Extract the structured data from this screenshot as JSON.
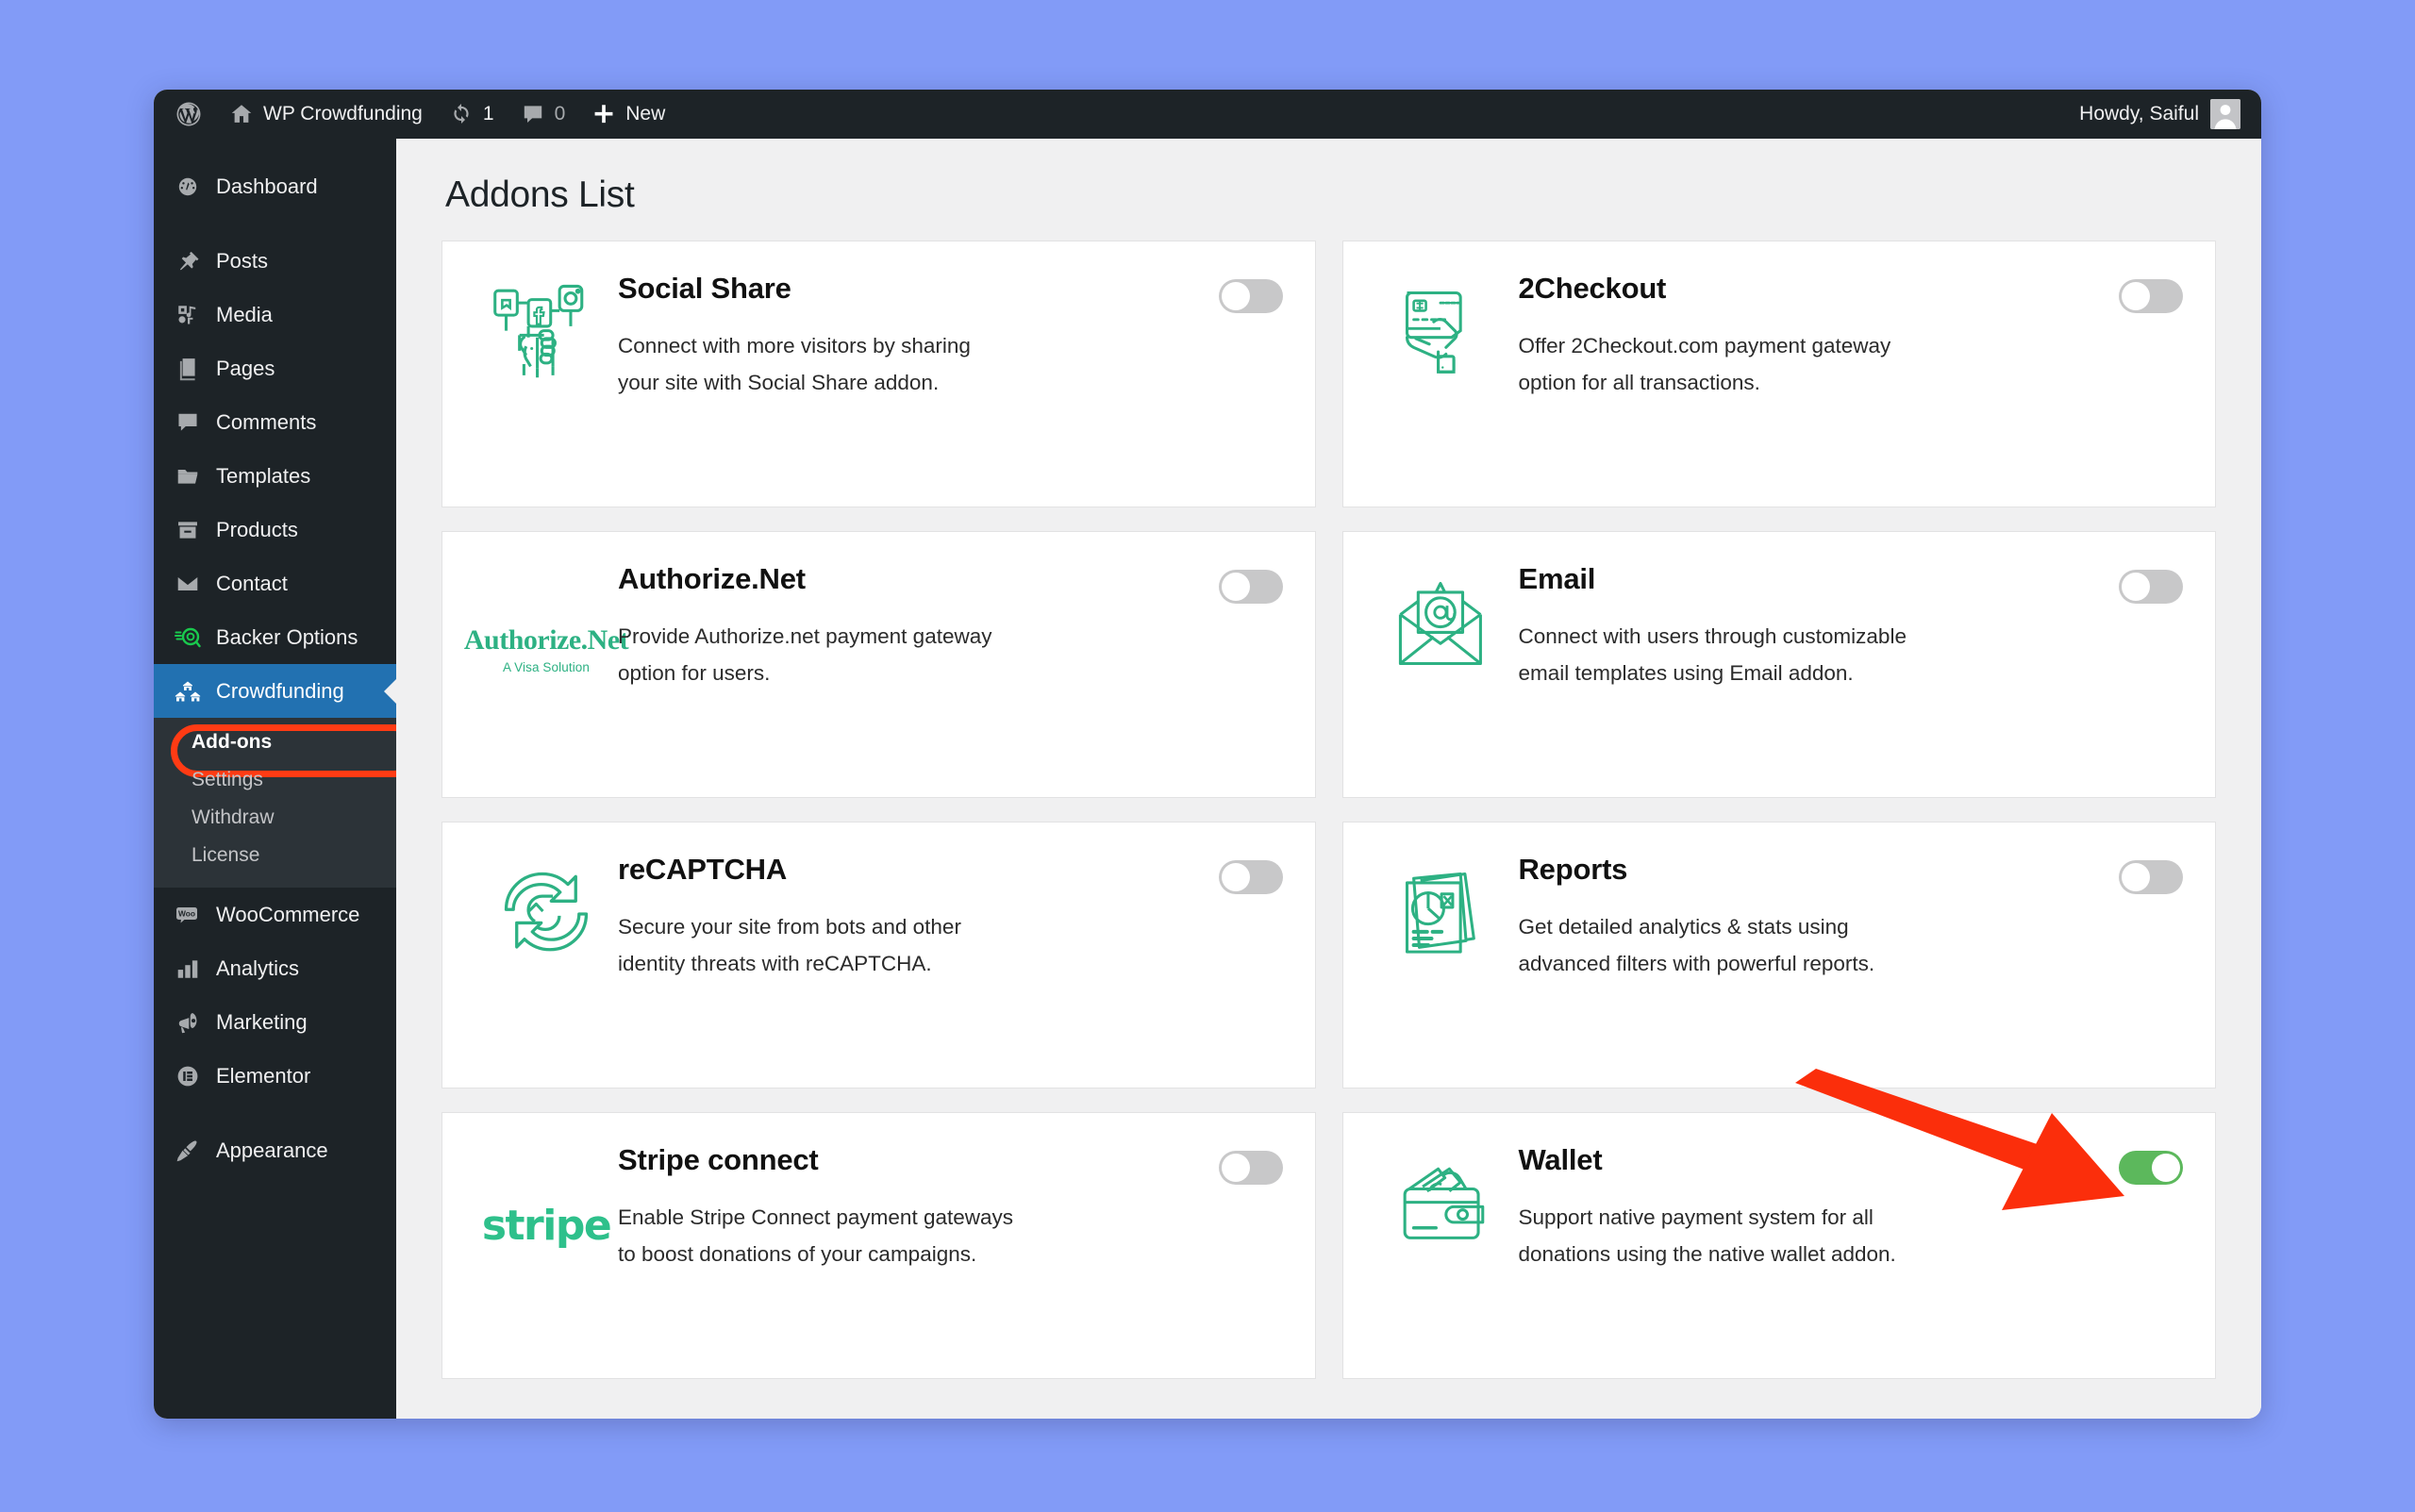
{
  "window": {
    "background_color": "#829bf7",
    "accent_blue": "#2271b1",
    "brand_green": "#2db183",
    "highlight_red": "#ff3b14"
  },
  "adminbar": {
    "site_name": "WP Crowdfunding",
    "updates_count": "1",
    "comments_count": "0",
    "new_label": "New",
    "howdy": "Howdy, Saiful"
  },
  "sidebar": {
    "items": [
      {
        "label": "Dashboard",
        "icon": "dashboard-icon",
        "active": false
      },
      {
        "label": "Posts",
        "icon": "pin-icon",
        "active": false
      },
      {
        "label": "Media",
        "icon": "media-icon",
        "active": false
      },
      {
        "label": "Pages",
        "icon": "pages-icon",
        "active": false
      },
      {
        "label": "Comments",
        "icon": "comment-icon",
        "active": false
      },
      {
        "label": "Templates",
        "icon": "folder-icon",
        "active": false
      },
      {
        "label": "Products",
        "icon": "products-icon",
        "active": false
      },
      {
        "label": "Contact",
        "icon": "envelope-icon",
        "active": false
      },
      {
        "label": "Backer Options",
        "icon": "backer-options-icon",
        "active": false
      },
      {
        "label": "Crowdfunding",
        "icon": "crowdfunding-icon",
        "active": true
      },
      {
        "label": "WooCommerce",
        "icon": "woo-icon",
        "active": false
      },
      {
        "label": "Analytics",
        "icon": "bar-chart-icon",
        "active": false
      },
      {
        "label": "Marketing",
        "icon": "megaphone-icon",
        "active": false
      },
      {
        "label": "Elementor",
        "icon": "elementor-icon",
        "active": false
      },
      {
        "label": "Appearance",
        "icon": "paintbrush-icon",
        "active": false
      }
    ],
    "submenu": [
      {
        "label": "Add-ons",
        "current": true
      },
      {
        "label": "Settings",
        "current": false
      },
      {
        "label": "Withdraw",
        "current": false
      },
      {
        "label": "License",
        "current": false
      }
    ]
  },
  "main": {
    "page_title": "Addons List",
    "addons": [
      {
        "name": "Social Share",
        "description": "Connect with more visitors by sharing your site with Social Share addon.",
        "icon": "social-share-icon",
        "enabled": false
      },
      {
        "name": "2Checkout",
        "description": "Offer 2Checkout.com payment gateway option for all transactions.",
        "icon": "credit-card-hand-icon",
        "enabled": false
      },
      {
        "name": "Authorize.Net",
        "description": "Provide Authorize.net payment gateway option for users.",
        "icon": "authorize-net-logo",
        "logo_text": "Authorize.Net",
        "logo_subtext": "A Visa Solution",
        "enabled": false
      },
      {
        "name": "Email",
        "description": "Connect with users through customizable email templates using Email addon.",
        "icon": "email-at-icon",
        "enabled": false
      },
      {
        "name": "reCAPTCHA",
        "description": "Secure your site from bots and other identity threats with reCAPTCHA.",
        "icon": "recaptcha-icon",
        "enabled": false
      },
      {
        "name": "Reports",
        "description": "Get detailed analytics & stats using advanced filters with powerful reports.",
        "icon": "reports-chart-icon",
        "enabled": false
      },
      {
        "name": "Stripe connect",
        "description": "Enable Stripe Connect payment gateways to boost donations of your campaigns.",
        "icon": "stripe-logo",
        "logo_text": "stripe",
        "enabled": false
      },
      {
        "name": "Wallet",
        "description": "Support native payment system for all donations using the native wallet addon.",
        "icon": "wallet-icon",
        "enabled": true
      }
    ]
  },
  "annotations": {
    "arrow_color": "#fb2e0b",
    "arrow_target": "wallet-enable-toggle",
    "highlight_target": "sidebar-submenu-item-add-ons"
  }
}
